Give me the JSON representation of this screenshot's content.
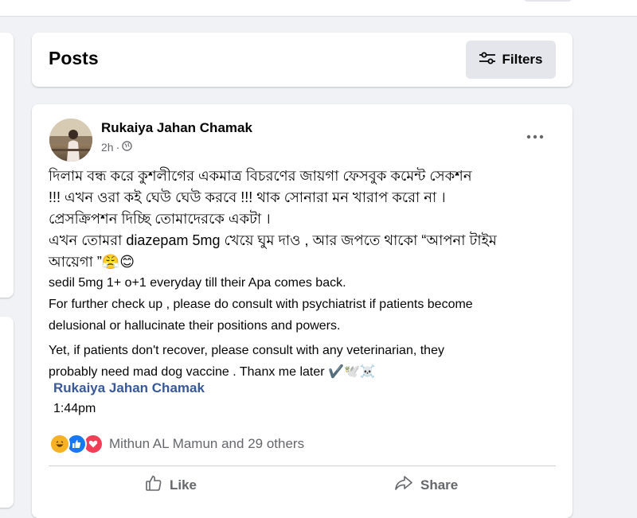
{
  "header": {
    "title": "Posts",
    "filters_label": "Filters"
  },
  "post": {
    "author": "Rukaiya Jahan Chamak",
    "time": "2h",
    "audience_icon": "globe-icon",
    "bangla_lines": [
      "দিলাম বন্ধ করে কুশলীগের একমাত্র বিচরণের জায়গা ফেসবুক কমেন্ট সেকশন",
      "!!! এখন ওরা কই ঘেউ ঘেউ করবে !!! থাক সোনারা মন খারাপ করো না ।",
      "প্রেসক্রিপশন দিচ্ছি তোমাদেরকে একটা ।",
      "এখন তোমরা diazepam 5mg খেয়ে ঘুম দাও , আর জপতে থাকো “আপনা টাইম",
      "আয়েগা ”"
    ],
    "line_emojis": "😤😊",
    "eng_lines": [
      " sedil 5mg   1+ o+1 everyday till their Apa comes back.",
      "For further check up , please do consult with psychiatrist if patients  become",
      "delusional or hallucinate their positions and powers."
    ],
    "eng_lines2": [
      "Yet, if patients don't recover, please consult with any veterinarian, they",
      "probably need mad dog vaccine . Thanx me later "
    ],
    "trail_emojis": "✔️🕊️☠️",
    "tagged_name": "Rukaiya Jahan Chamak",
    "time2": "1:44pm",
    "reactions": [
      "haha-icon",
      "like-icon",
      "love-icon"
    ],
    "reaction_count": "Mithun AL Mamun and 29 others",
    "actions": {
      "like": "Like",
      "share": "Share"
    }
  },
  "colors": {
    "background": "#f0f2f5",
    "card": "#ffffff",
    "link": "#385898",
    "like_blue": "#1877f2",
    "love_red": "#f33e58",
    "haha_yellow": "#f7b125"
  }
}
